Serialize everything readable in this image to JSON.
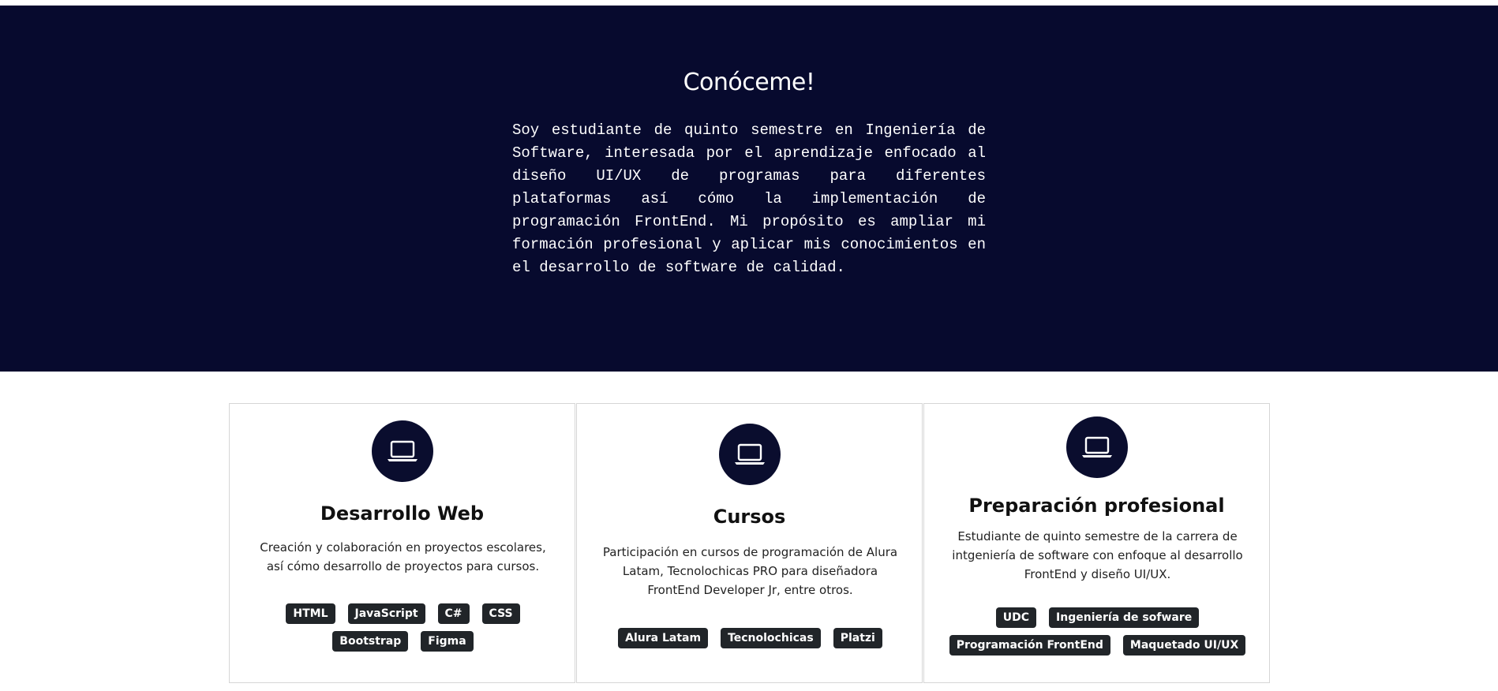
{
  "about": {
    "title": "Conóceme!",
    "text": "Soy estudiante de quinto semestre en Ingeniería de Software, interesada por el aprendizaje enfocado al diseño UI/UX de programas para diferentes plataformas así cómo la implementación de programación FrontEnd. Mi propósito es ampliar mi formación profesional y aplicar mis conocimientos en el desarrollo de software de calidad."
  },
  "colors": {
    "hero_bg": "#070a2e",
    "icon_circle": "#0a0d2e",
    "tag_bg": "#212529"
  },
  "cards": [
    {
      "icon": "laptop-icon",
      "title": "Desarrollo Web",
      "description": "Creación y colaboración en proyectos escolares, así cómo desarrollo de proyectos para cursos.",
      "tags": [
        "HTML",
        "JavaScript",
        "C#",
        "CSS",
        "Bootstrap",
        "Figma"
      ]
    },
    {
      "icon": "laptop-icon",
      "title": "Cursos",
      "description": "Participación en cursos de programación de Alura Latam, Tecnolochicas PRO para diseñadora FrontEnd Developer Jr, entre otros.",
      "tags": [
        "Alura Latam",
        "Tecnolochicas",
        "Platzi"
      ]
    },
    {
      "icon": "laptop-icon",
      "title": "Preparación profesional",
      "description": "Estudiante de quinto semestre de la carrera de intgeniería de software con enfoque al desarrollo FrontEnd y diseño UI/UX.",
      "tags": [
        "UDC",
        "Ingeniería de sofware",
        "Programación FrontEnd",
        "Maquetado UI/UX"
      ]
    }
  ]
}
